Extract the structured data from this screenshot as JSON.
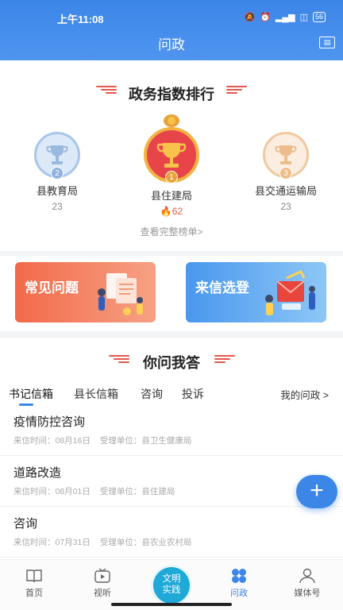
{
  "status_bar": {
    "time": "上午11:08",
    "battery": "56"
  },
  "header": {
    "title": "问政"
  },
  "ranking": {
    "title": "政务指数排行",
    "items": [
      {
        "rank": "2",
        "name": "县教育局",
        "score": "23",
        "color": "#a8c6ea"
      },
      {
        "rank": "1",
        "name": "县住建局",
        "score": "62",
        "color": "#e8a23a"
      },
      {
        "rank": "3",
        "name": "县交通运输局",
        "score": "23",
        "color": "#f0c9a0"
      }
    ],
    "view_all": "查看完整榜单>"
  },
  "banners": {
    "left": {
      "label": "常见问题",
      "color": "#f0684c"
    },
    "right": {
      "label": "来信选登",
      "color": "#5aa7f0"
    }
  },
  "qa": {
    "title": "你问我答",
    "tabs": [
      "书记信箱",
      "县长信箱",
      "咨询",
      "投诉"
    ],
    "my_questions": "我的问政 >",
    "items": [
      {
        "title": "疫情防控咨询",
        "date": "来信时间：08月16日",
        "unit": "受理单位：县卫生健康局"
      },
      {
        "title": "道路改造",
        "date": "来信时间：08月01日",
        "unit": "受理单位：县住建局"
      },
      {
        "title": "咨询",
        "date": "来信时间：07月31日",
        "unit": "受理单位：县农业农村局"
      }
    ]
  },
  "fab": {
    "label": "+"
  },
  "bottom_nav": {
    "home": "首页",
    "video": "视听",
    "center": "文明实践",
    "center_line1": "文明",
    "center_line2": "实践",
    "wenzheng": "问政",
    "media": "媒体号"
  },
  "colors": {
    "accent": "#3c86e8",
    "hot": "#e85b3c"
  }
}
